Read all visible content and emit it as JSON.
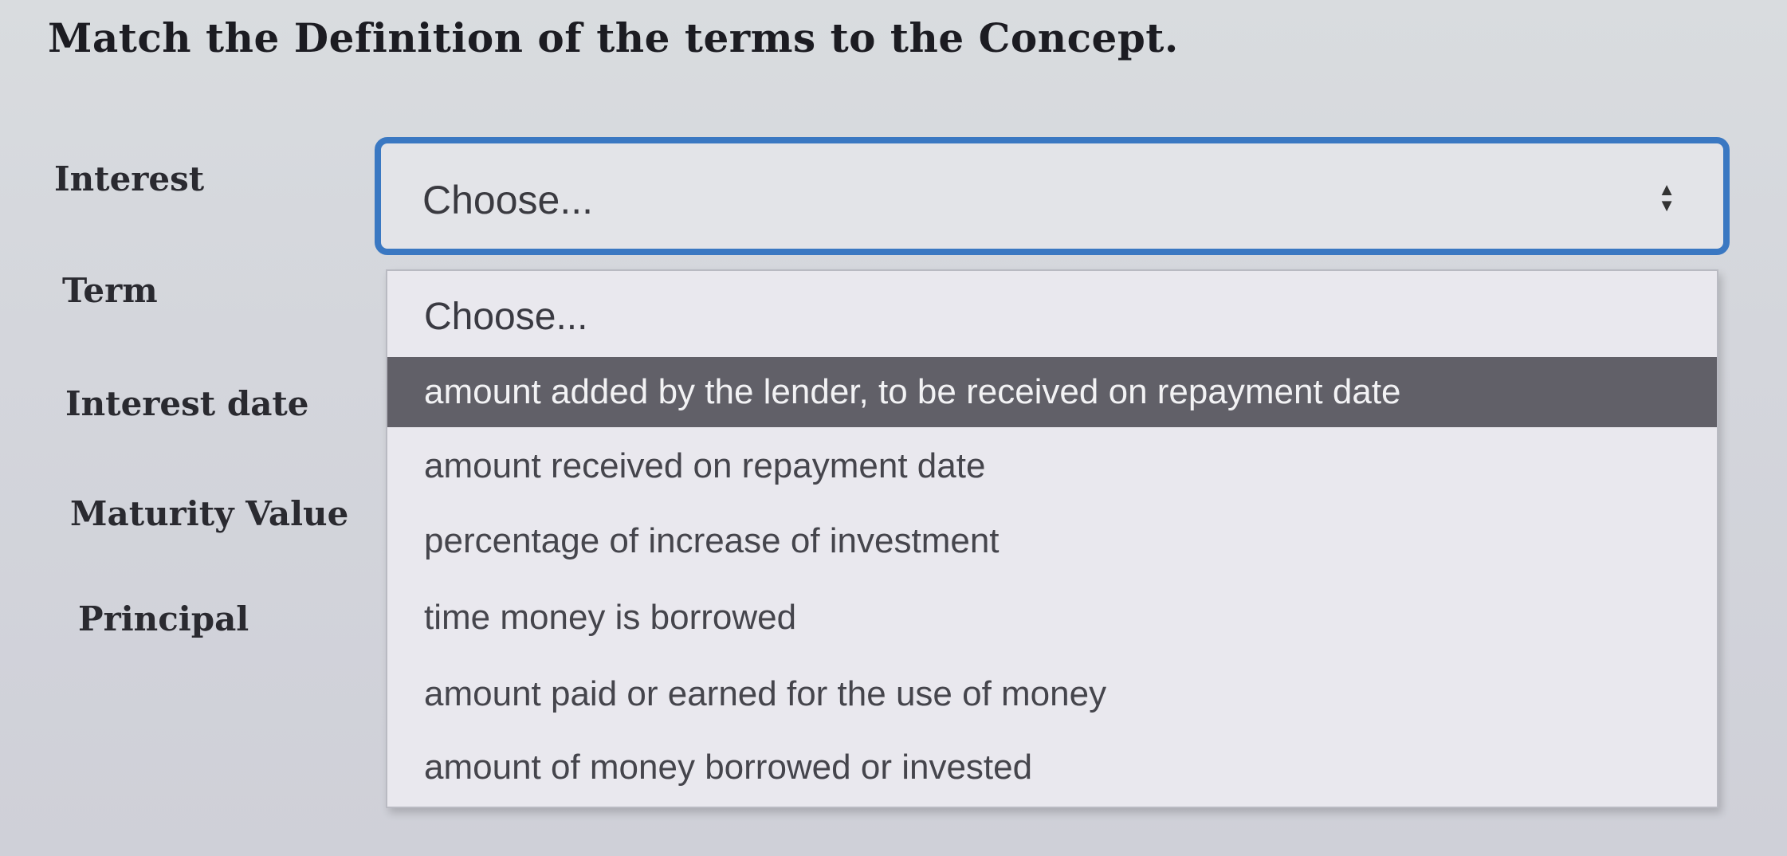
{
  "question": "Match the Definition of the terms to the Concept.",
  "terms": [
    "Interest",
    "Term",
    "Interest date",
    "Maturity Value",
    "Principal"
  ],
  "select": {
    "selected": "Choose...",
    "arrow_icon": "updown-arrows-icon"
  },
  "dropdown": {
    "options": [
      "Choose...",
      "amount added by the lender, to be received on repayment date",
      "amount received on repayment date",
      "percentage of increase of investment",
      "time money is borrowed",
      "amount paid or earned for the use of money",
      "amount of money borrowed or invested"
    ],
    "highlighted_index": 1
  },
  "colors": {
    "focus_border": "#3a78c2",
    "highlight_bg": "#616068",
    "background": "#d6d8dd"
  }
}
